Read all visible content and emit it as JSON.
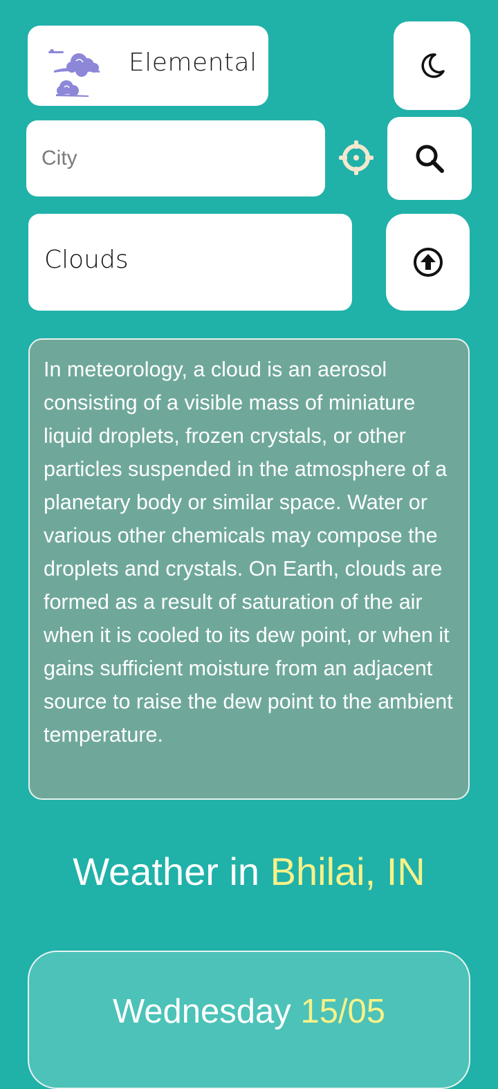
{
  "app": {
    "title": "Elemental",
    "logo_icon": "clouds-logo-icon"
  },
  "header": {
    "theme_toggle_icon": "moon-icon"
  },
  "search": {
    "placeholder": "City",
    "value": "",
    "locate_icon": "crosshair-icon",
    "search_icon": "search-icon"
  },
  "weather_type": {
    "label": "Clouds",
    "scroll_top_icon": "arrow-up-circle-icon"
  },
  "description": "In meteorology, a cloud is an aerosol consisting of a visible mass of miniature liquid droplets, frozen crystals, or other particles suspended in the atmosphere of a planetary body or similar space. Water or various other chemicals may compose the droplets and crystals. On Earth, clouds are formed as a result of saturation of the air when it is cooled to its dew point, or when it gains sufficient moisture from an adjacent source to raise the dew point to the ambient temperature.",
  "weather": {
    "prefix": "Weather in ",
    "location": "Bhilai, IN"
  },
  "forecast": {
    "day": "Wednesday",
    "date": "15/05"
  },
  "colors": {
    "background": "#20b1a9",
    "highlight": "#f6f28a",
    "description_bg": "#6fa89a",
    "logo": "#8d87d8",
    "locate": "#f3e8cf"
  }
}
